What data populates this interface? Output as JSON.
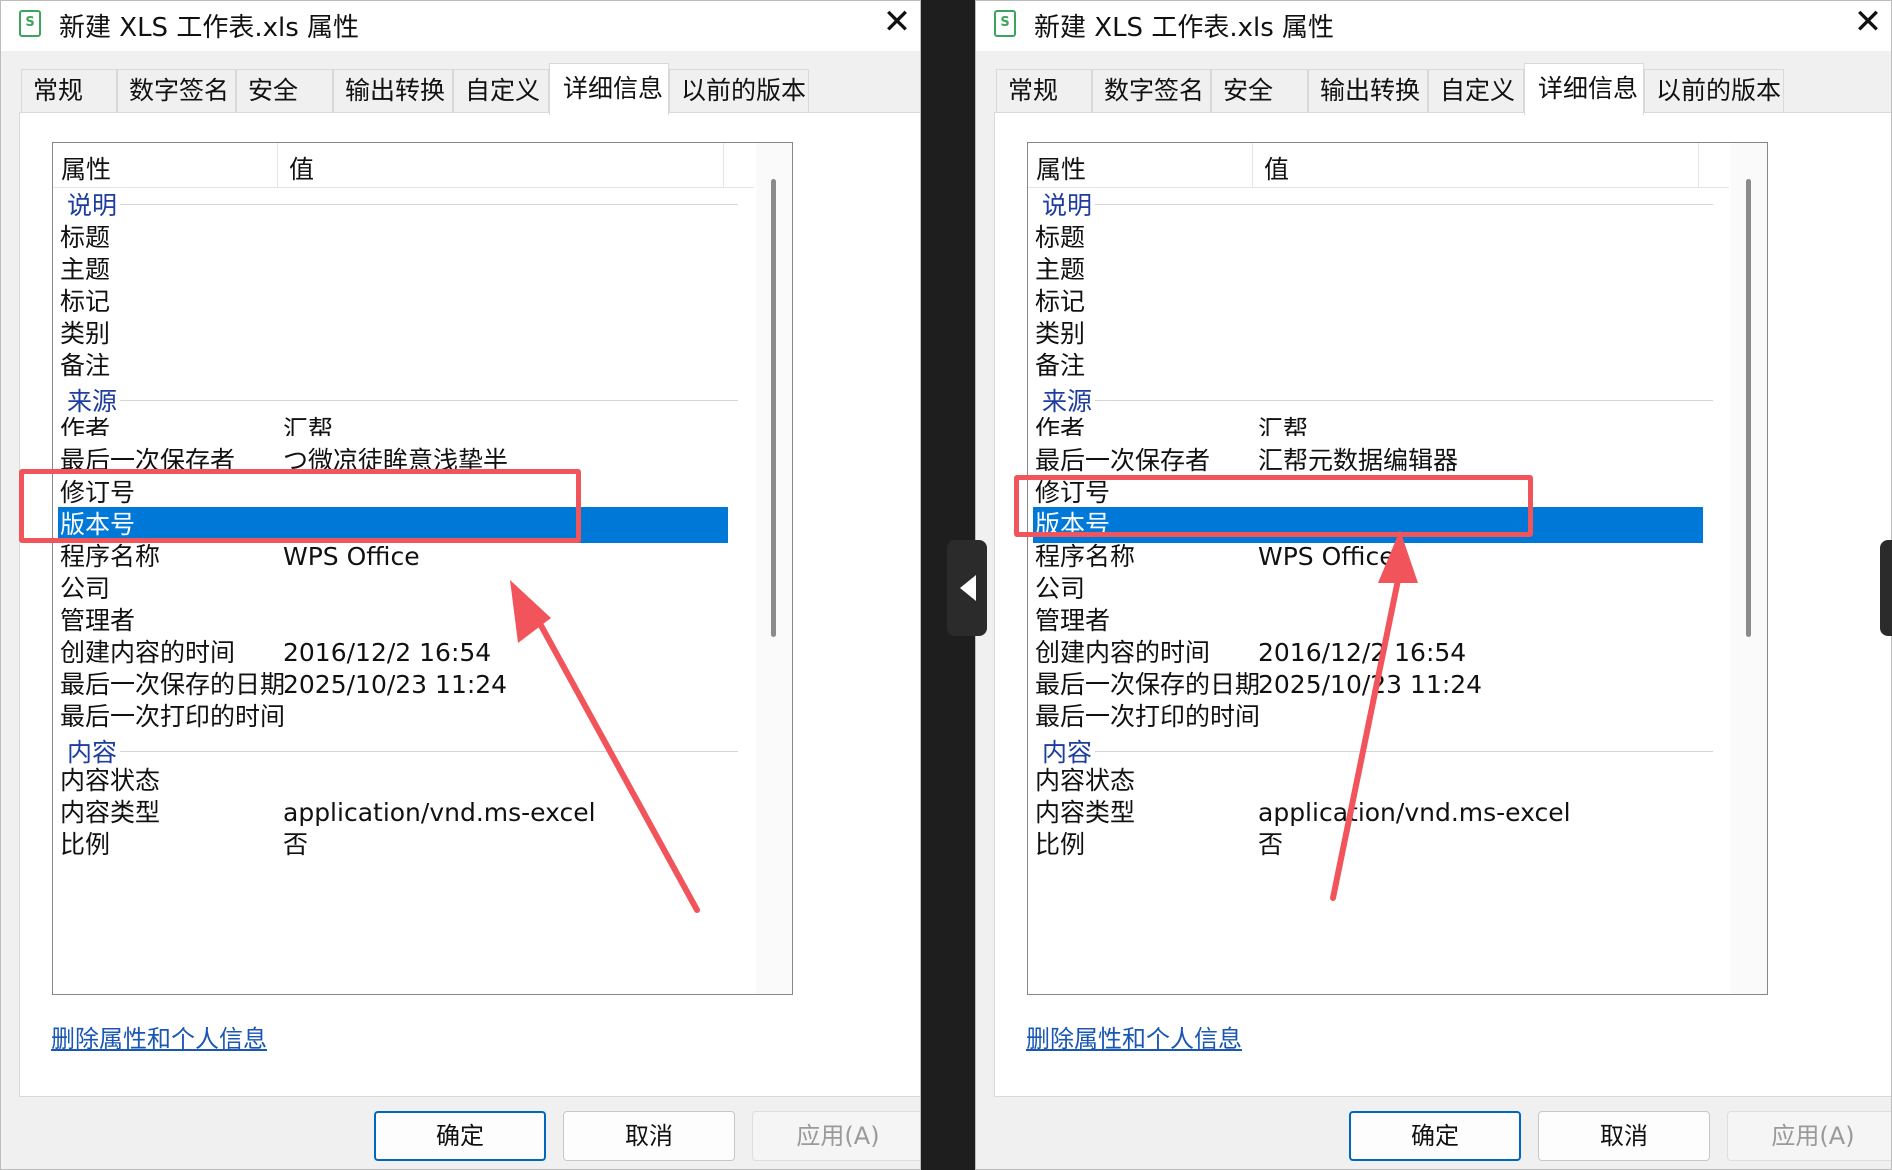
{
  "dialogs": [
    {
      "title": "新建 XLS 工作表.xls 属性",
      "app_icon": "S",
      "close_glyph": "✕",
      "tabs": [
        {
          "label": "常规"
        },
        {
          "label": "数字签名"
        },
        {
          "label": "安全"
        },
        {
          "label": "输出转换"
        },
        {
          "label": "自定义"
        },
        {
          "label": "详细信息"
        },
        {
          "label": "以前的版本"
        }
      ],
      "active_tab": "详细信息",
      "columns": {
        "property": "属性",
        "value": "值"
      },
      "groups": {
        "description": "说明",
        "origin": "来源",
        "content": "内容"
      },
      "rows": {
        "title": {
          "key": "标题",
          "value": ""
        },
        "subject": {
          "key": "主题",
          "value": ""
        },
        "tags": {
          "key": "标记",
          "value": ""
        },
        "category": {
          "key": "类别",
          "value": ""
        },
        "comments": {
          "key": "备注",
          "value": ""
        },
        "author": {
          "key": "作者",
          "value": "汇帮"
        },
        "last_saved_by": {
          "key": "最后一次保存者",
          "value": "つ微凉徒眸意浅挚半"
        },
        "revision": {
          "key": "修订号",
          "value": ""
        },
        "version": {
          "key": "版本号",
          "value": ""
        },
        "program": {
          "key": "程序名称",
          "value": "WPS Office"
        },
        "company": {
          "key": "公司",
          "value": ""
        },
        "manager": {
          "key": "管理者",
          "value": ""
        },
        "created": {
          "key": "创建内容的时间",
          "value": "2016/12/2 16:54"
        },
        "last_saved": {
          "key": "最后一次保存的日期",
          "value": "2025/10/23 11:24"
        },
        "last_printed": {
          "key": "最后一次打印的时间",
          "value": ""
        },
        "content_status": {
          "key": "内容状态",
          "value": ""
        },
        "content_type": {
          "key": "内容类型",
          "value": "application/vnd.ms-excel"
        },
        "scale": {
          "key": "比例",
          "value": "否"
        }
      },
      "selected_row": "版本号",
      "remove_link": "删除属性和个人信息",
      "buttons": {
        "ok": "确定",
        "cancel": "取消",
        "apply": "应用(A)"
      }
    },
    {
      "title": "新建 XLS 工作表.xls 属性",
      "app_icon": "S",
      "close_glyph": "✕",
      "tabs": [
        {
          "label": "常规"
        },
        {
          "label": "数字签名"
        },
        {
          "label": "安全"
        },
        {
          "label": "输出转换"
        },
        {
          "label": "自定义"
        },
        {
          "label": "详细信息"
        },
        {
          "label": "以前的版本"
        }
      ],
      "active_tab": "详细信息",
      "columns": {
        "property": "属性",
        "value": "值"
      },
      "groups": {
        "description": "说明",
        "origin": "来源",
        "content": "内容"
      },
      "rows": {
        "title": {
          "key": "标题",
          "value": ""
        },
        "subject": {
          "key": "主题",
          "value": ""
        },
        "tags": {
          "key": "标记",
          "value": ""
        },
        "category": {
          "key": "类别",
          "value": ""
        },
        "comments": {
          "key": "备注",
          "value": ""
        },
        "author": {
          "key": "作者",
          "value": "汇帮"
        },
        "last_saved_by": {
          "key": "最后一次保存者",
          "value": "汇帮元数据编辑器"
        },
        "revision": {
          "key": "修订号",
          "value": ""
        },
        "version": {
          "key": "版本号",
          "value": ""
        },
        "program": {
          "key": "程序名称",
          "value": "WPS Office"
        },
        "company": {
          "key": "公司",
          "value": ""
        },
        "manager": {
          "key": "管理者",
          "value": ""
        },
        "created": {
          "key": "创建内容的时间",
          "value": "2016/12/2 16:54"
        },
        "last_saved": {
          "key": "最后一次保存的日期",
          "value": "2025/10/23 11:24"
        },
        "last_printed": {
          "key": "最后一次打印的时间",
          "value": ""
        },
        "content_status": {
          "key": "内容状态",
          "value": ""
        },
        "content_type": {
          "key": "内容类型",
          "value": "application/vnd.ms-excel"
        },
        "scale": {
          "key": "比例",
          "value": "否"
        }
      },
      "selected_row": "版本号",
      "remove_link": "删除属性和个人信息",
      "buttons": {
        "ok": "确定",
        "cancel": "取消",
        "apply": "应用(A)"
      }
    }
  ],
  "annotations": {
    "highlight_color": "#f2545b",
    "arrow_color": "#f2545b"
  },
  "colors": {
    "selection": "#0078d7",
    "group_label": "#1e3d9e",
    "link": "#1a57b5"
  },
  "icons": {
    "app": "spreadsheet-file-icon",
    "close": "close-icon",
    "splitter": "triangle-left-icon"
  }
}
